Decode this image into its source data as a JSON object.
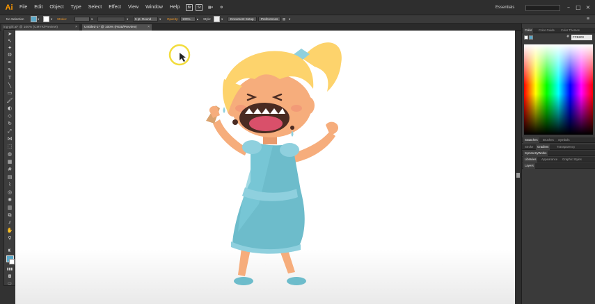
{
  "app": {
    "logo": "Ai"
  },
  "menu": {
    "items": [
      "File",
      "Edit",
      "Object",
      "Type",
      "Select",
      "Effect",
      "View",
      "Window",
      "Help"
    ],
    "workspace": "Essentials"
  },
  "control": {
    "selection": "No Selection",
    "stroke_label": "Stroke:",
    "brush": "5 pt. Round",
    "opacity_label": "Opacity:",
    "opacity_value": "100%",
    "style_label": "Style:",
    "doc_setup": "Document Setup",
    "preferences": "Preferences"
  },
  "tabs": [
    {
      "label": "ing-girl.ai* @ 100% (CMYK/Preview)"
    },
    {
      "label": "Untitled-1* @ 100% (RGB/Preview)"
    }
  ],
  "panels": {
    "color_tabs": [
      "Color",
      "Color Guide",
      "Color Themes"
    ],
    "hex": "FFB800",
    "swatch_tabs": [
      "Swatches",
      "Brushes",
      "Symbols"
    ],
    "stroke_tabs": [
      "Stroke",
      "Gradient",
      "Transparency"
    ],
    "symmetry": "SymmetryWorks",
    "lib_tabs": [
      "Libraries",
      "Appearance",
      "Graphic Styles"
    ],
    "layers": "Layers"
  },
  "colors": {
    "skin": "#f6ad7c",
    "hair": "#fdd36c",
    "dress": "#6dbccb",
    "mouth": "#4a2b22",
    "cursor_ring": "#f2dc3c"
  }
}
